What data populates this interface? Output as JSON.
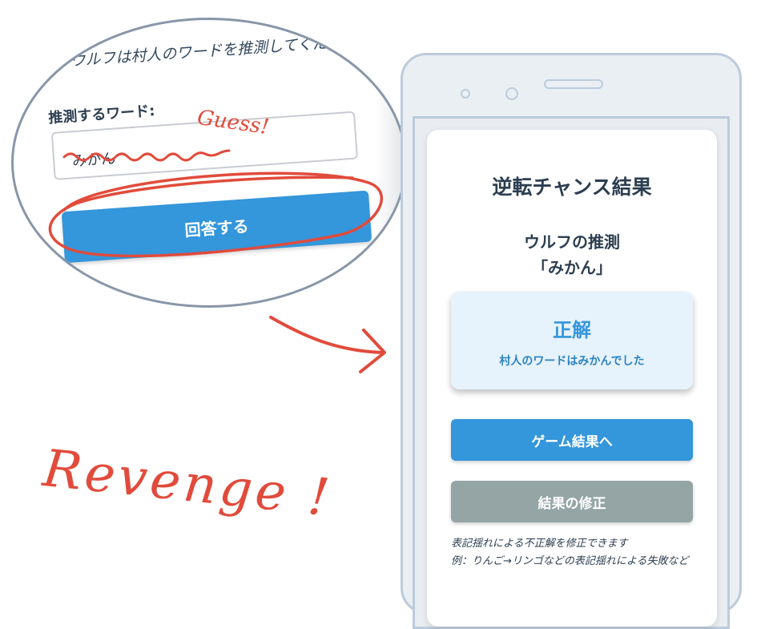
{
  "zoom": {
    "instruction_text": "ウルフは村人のワードを推測してくだ",
    "input_label": "推測するワード:",
    "input_value": "みかん",
    "submit_label": "回答する",
    "annotation_guess": "Guess!"
  },
  "annotation_revenge": "Revenge !",
  "result_screen": {
    "title": "逆転チャンス結果",
    "guess_heading": "ウルフの推測",
    "guess_value": "「みかん」",
    "result_title": "正解",
    "result_detail": "村人のワードはみかんでした",
    "game_result_button": "ゲーム結果へ",
    "fix_result_button": "結果の修正",
    "note_line1": "表記揺れによる不正解を修正できます",
    "note_line2": "例：りんご→リンゴなどの表記揺れによる失敗など"
  },
  "colors": {
    "primary": "#3496db",
    "secondary": "#95a5a6",
    "annotation": "#e14b3b",
    "result_bg": "#e6f2fc"
  }
}
